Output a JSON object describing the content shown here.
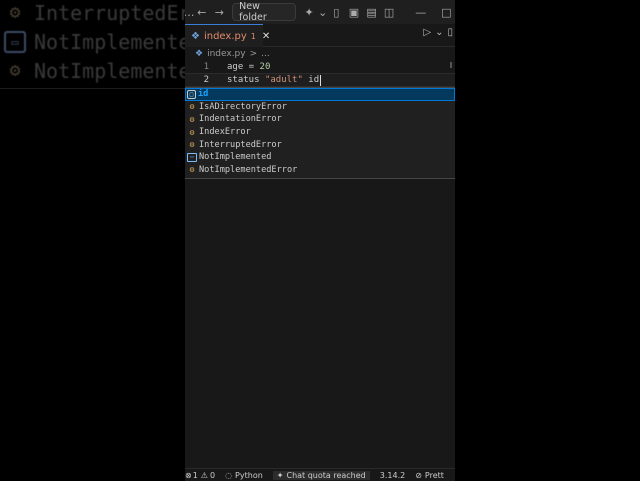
{
  "backdrop": {
    "lines": [
      {
        "text": "InterruptedEr",
        "icon": "class-icon"
      },
      {
        "text": "NotImplemented",
        "icon": "enum-member-icon"
      },
      {
        "text": "NotImplemente",
        "icon": "class-icon"
      }
    ]
  },
  "titlebar": {
    "back_label": "←",
    "forward_label": "→",
    "search_text": "New folder",
    "window_minimize": "—",
    "window_maximize": "□"
  },
  "tabs": [
    {
      "label": "index.py",
      "count": "1",
      "close": "✕"
    }
  ],
  "breadcrumb": {
    "file": "index.py",
    "separator": ">",
    "more": "..."
  },
  "editor": {
    "lines": [
      {
        "number": "1",
        "tokens": [
          "age",
          " = ",
          "20"
        ]
      },
      {
        "number": "2",
        "tokens": [
          "status",
          " ",
          "\"adult\"",
          " id"
        ]
      }
    ]
  },
  "suggestions": [
    {
      "label": "id",
      "match": "id",
      "rest": "",
      "kind": "keyword",
      "selected": true
    },
    {
      "label": "IsADirectoryError",
      "kind": "class",
      "selected": false
    },
    {
      "label": "IndentationError",
      "kind": "class",
      "selected": false
    },
    {
      "label": "IndexError",
      "kind": "class",
      "selected": false
    },
    {
      "label": "InterruptedError",
      "kind": "class",
      "selected": false
    },
    {
      "label": "NotImplemented",
      "kind": "enum-member",
      "selected": false
    },
    {
      "label": "NotImplementedError",
      "kind": "class",
      "selected": false
    }
  ],
  "statusbar": {
    "errors": "1",
    "warnings": "0",
    "language": "Python",
    "chat": "Chat quota reached",
    "version": "3.14.2",
    "formatter": "Prett"
  }
}
